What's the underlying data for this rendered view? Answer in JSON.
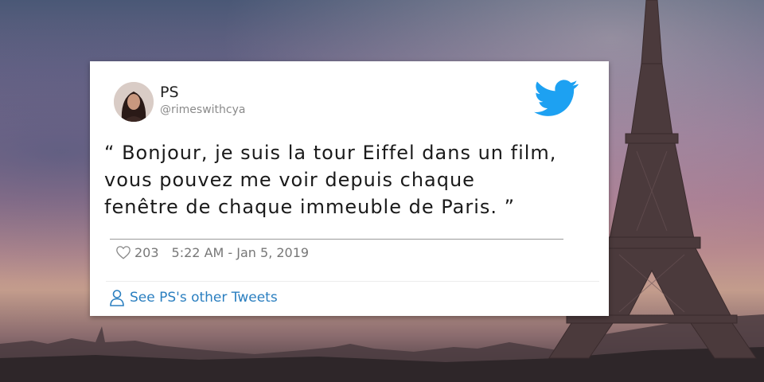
{
  "tweet": {
    "author_name": "PS",
    "handle": "@rimeswithcya",
    "text": "“ Bonjour, je suis la tour Eiffel dans un film,\nvous pouvez me voir depuis chaque\nfenêtre de chaque immeuble de Paris. ”",
    "likes": "203",
    "timestamp": "5:22 AM - Jan 5, 2019",
    "see_more_label": "See PS's other Tweets"
  },
  "icons": {
    "brand": "twitter-bird-icon",
    "like": "heart-icon",
    "profile": "person-icon"
  },
  "colors": {
    "twitter_blue": "#1da1f2",
    "link_blue": "#2b7fc0",
    "card_bg": "#ffffff"
  }
}
